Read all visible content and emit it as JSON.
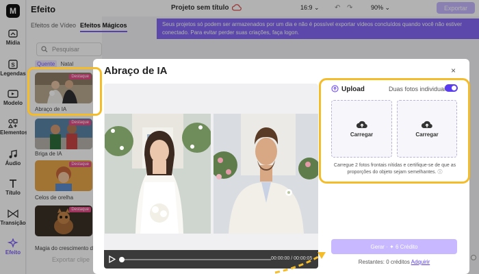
{
  "app": {
    "logo": "M",
    "project_title": "Projeto sem título",
    "aspect_ratio": "16:9",
    "zoom": "90%",
    "export_label": "Exportar",
    "accent_color": "#7b5cf5",
    "highlight_color": "#f5bc2a"
  },
  "rail": {
    "items": [
      {
        "label": "Mídia",
        "icon": "media-icon"
      },
      {
        "label": "Legendas",
        "icon": "captions-icon"
      },
      {
        "label": "Modelo",
        "icon": "template-icon"
      },
      {
        "label": "Elementos",
        "icon": "elements-icon"
      },
      {
        "label": "Áudio",
        "icon": "audio-icon"
      },
      {
        "label": "Título",
        "icon": "title-icon"
      },
      {
        "label": "Transição",
        "icon": "transition-icon"
      },
      {
        "label": "Efeito",
        "icon": "effect-icon",
        "active": true
      }
    ]
  },
  "panel": {
    "title": "Efeito",
    "tabs": [
      "Efeitos de Vídeo",
      "Efeitos Mágicos"
    ],
    "search_placeholder": "Pesquisar",
    "chips": [
      "Quente",
      "Natal"
    ],
    "cards": [
      {
        "label": "Abraço de IA",
        "badge": "Destaque"
      },
      {
        "label": "Briga de IA",
        "badge": "Destaque"
      },
      {
        "label": "Celos de orelha",
        "badge": "Destaque"
      },
      {
        "label": "Magia do crescimento d...",
        "badge": "Destaque"
      }
    ],
    "export_ghost": "Exportar clipe"
  },
  "banner": {
    "text": "Seus projetos só podem ser armazenados por um dia e não é possível exportar vídeos concluídos quando você não estiver conectado. Para evitar perder suas criações, faça logon."
  },
  "modal": {
    "title": "Abraço de IA",
    "close_label": "×",
    "player": {
      "time": "00:00:00 / 00:00:05",
      "progress": 0
    },
    "upload": {
      "title": "Upload",
      "toggle_label": "Duas fotos individuais",
      "toggle_on": true,
      "slot_label": "Carregar",
      "hint": "Carregue 2 fotos frontais nítidas e certifique-se de que as proporções do objeto sejam semelhantes."
    },
    "generate_label": "Gerar · ✦ 6 Crédito",
    "remaining_text": "Restantes: 0 créditos",
    "acquire_label": "Adquirir"
  }
}
